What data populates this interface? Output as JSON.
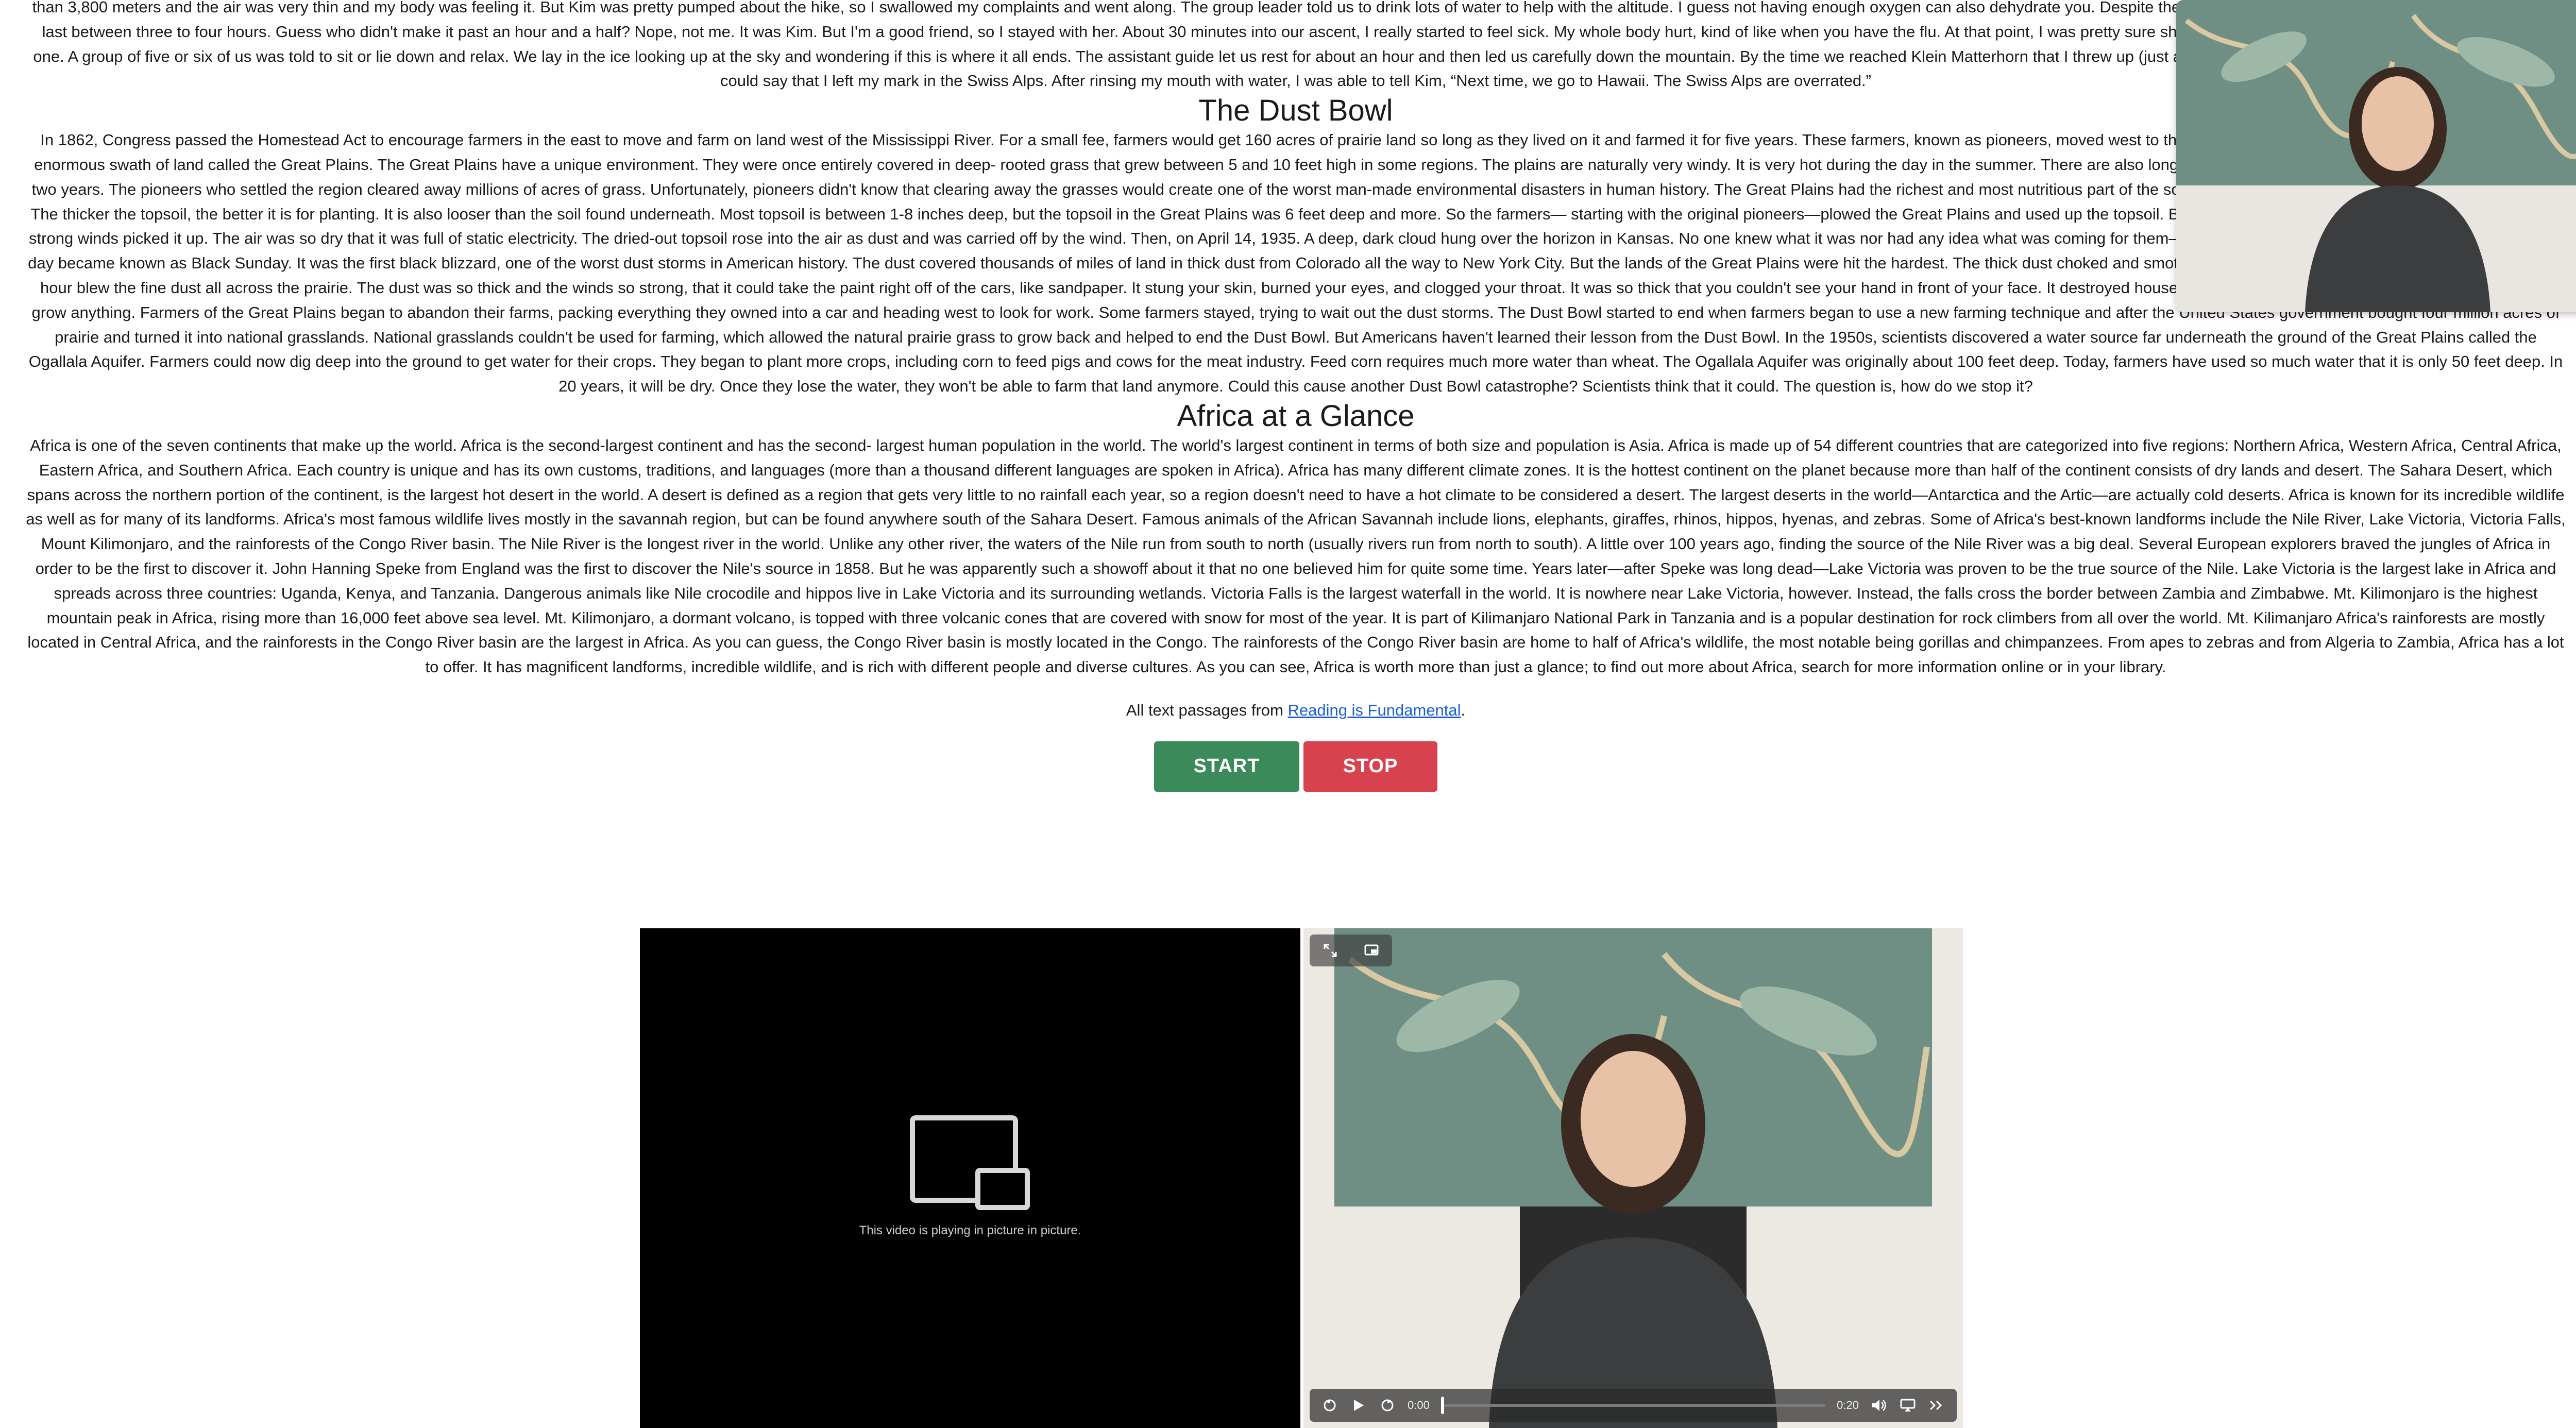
{
  "passages": {
    "hike_tail": "than 3,800 meters and the air was very thin and my body was feeling it. But Kim was pretty pumped about the hike, so I swallowed my complaints and went along. The group leader told us to drink lots of water to help with the altitude. I guess not having enough oxygen can also dehydrate you. Despite the water, I began to feel sick. The hike was supposed to last between three to four hours. Guess who didn't make it past an hour and a half? Nope, not me. It was Kim. But I'm a good friend, so I stayed with her. About 30 minutes into our ascent, I really started to feel sick. My whole body hurt, kind of like when you have the flu. At that point, I was pretty sure she couldn't go any farther. Luckily, Kim wasn't the only one. A group of five or six of us was told to sit or lie down and relax. We lay in the ice looking up at the sky and wondering if this is where it all ends. The assistant guide let us rest for about an hour and then led us carefully down the mountain. By the time we reached Klein Matterhorn that I threw up (just another fun symptom of altitude sickness). I guess you could say that I left my mark in the Swiss Alps. After rinsing my mouth with water, I was able to tell Kim, “Next time, we go to Hawaii. The Swiss Alps are overrated.”",
    "dust_bowl": {
      "title": "The Dust Bowl",
      "body": "In 1862, Congress passed the Homestead Act to encourage farmers in the east to move and farm on land west of the Mississippi River. For a small fee, farmers would get 160 acres of prairie land so long as they lived on it and farmed it for five years. These farmers, known as pioneers, moved west to the prairie land. The prairie land was located across an enormous swath of land called the Great Plains. The Great Plains have a unique environment. They were once entirely covered in deep- rooted grass that grew between 5 and 10 feet high in some regions. The plains are naturally very windy. It is very hot during the day in the summer. There are also long droughts (periods of little rain falls) that can last up to two years. The pioneers who settled the region cleared away millions of acres of grass. Unfortunately, pioneers didn't know that clearing away the grasses would create one of the worst man-made environmental disasters in human history. The Great Plains had the richest and most nutritious part of the soil. Topsoil is the soil in which farmers plant their crops. The thicker the topsoil, the better it is for planting. It is also looser than the soil found underneath. Most topsoil is between 1-8 inches deep, but the topsoil in the Great Plains was 6 feet deep and more. So the farmers— starting with the original pioneers—plowed the Great Plains and used up the topsoil. By 1934, the rain stopped, the topsoil dried out, and the strong winds picked it up. The air was so dry that it was full of static electricity. The dried-out topsoil rose into the air as dust and was carried off by the wind. Then, on April 14, 1935. A deep, dark cloud hung over the horizon in Kansas. No one knew what it was nor had any idea what was coming for them—some people thought it was the end of the world. This day became known as Black Sunday. It was the first black blizzard, one of the worst dust storms in American history. The dust covered thousands of miles of land in thick dust from Colorado all the way to New York City. But the lands of the Great Plains were hit the hardest. The thick dust choked and smothered farmers, even indoors. Winds of 40-60 miles per hour blew the fine dust all across the prairie. The dust was so thick and the winds so strong, that it could take the paint right off of the cars, like sandpaper. It stung your skin, burned your eyes, and clogged your throat. It was so thick that you couldn't see your hand in front of your face. It destroyed houses and buildings, too. Worst of all, it was impossible to grow anything. Farmers of the Great Plains began to abandon their farms, packing everything they owned into a car and heading west to look for work. Some farmers stayed, trying to wait out the dust storms. The Dust Bowl started to end when farmers began to use a new farming technique and after the United States government bought four million acres of prairie and turned it into national grasslands. National grasslands couldn't be used for farming, which allowed the natural prairie grass to grow back and helped to end the Dust Bowl. But Americans haven't learned their lesson from the Dust Bowl. In the 1950s, scientists discovered a water source far underneath the ground of the Great Plains called the Ogallala Aquifer. Farmers could now dig deep into the ground to get water for their crops. They began to plant more crops, including corn to feed pigs and cows for the meat industry. Feed corn requires much more water than wheat. The Ogallala Aquifer was originally about 100 feet deep. Today, farmers have used so much water that it is only 50 feet deep. In 20 years, it will be dry. Once they lose the water, they won't be able to farm that land anymore. Could this cause another Dust Bowl catastrophe? Scientists think that it could. The question is, how do we stop it?"
    },
    "africa": {
      "title": "Africa at a Glance",
      "body": "Africa is one of the seven continents that make up the world. Africa is the second-largest continent and has the second- largest human population in the world. The world's largest continent in terms of both size and population is Asia. Africa is made up of 54 different countries that are categorized into five regions: Northern Africa, Western Africa, Central Africa, Eastern Africa, and Southern Africa. Each country is unique and has its own customs, traditions, and languages (more than a thousand different languages are spoken in Africa). Africa has many different climate zones. It is the hottest continent on the planet because more than half of the continent consists of dry lands and desert. The Sahara Desert, which spans across the northern portion of the continent, is the largest hot desert in the world. A desert is defined as a region that gets very little to no rainfall each year, so a region doesn't need to have a hot climate to be considered a desert. The largest deserts in the world—Antarctica and the Artic—are actually cold deserts. Africa is known for its incredible wildlife as well as for many of its landforms. Africa's most famous wildlife lives mostly in the savannah region, but can be found anywhere south of the Sahara Desert. Famous animals of the African Savannah include lions, elephants, giraffes, rhinos, hippos, hyenas, and zebras. Some of Africa's best-known landforms include the Nile River, Lake Victoria, Victoria Falls, Mount Kilimonjaro, and the rainforests of the Congo River basin. The Nile River is the longest river in the world. Unlike any other river, the waters of the Nile run from south to north (usually rivers run from north to south). A little over 100 years ago, finding the source of the Nile River was a big deal. Several European explorers braved the jungles of Africa in order to be the first to discover it. John Hanning Speke from England was the first to discover the Nile's source in 1858. But he was apparently such a showoff about it that no one believed him for quite some time. Years later—after Speke was long dead—Lake Victoria was proven to be the true source of the Nile. Lake Victoria is the largest lake in Africa and spreads across three countries: Uganda, Kenya, and Tanzania. Dangerous animals like Nile crocodile and hippos live in Lake Victoria and its surrounding wetlands. Victoria Falls is the largest waterfall in the world. It is nowhere near Lake Victoria, however. Instead, the falls cross the border between Zambia and Zimbabwe. Mt. Kilimonjaro is the highest mountain peak in Africa, rising more than 16,000 feet above sea level. Mt. Kilimonjaro, a dormant volcano, is topped with three volcanic cones that are covered with snow for most of the year. It is part of Kilimanjaro National Park in Tanzania and is a popular destination for rock climbers from all over the world. Mt. Kilimanjaro Africa's rainforests are mostly located in Central Africa, and the rainforests in the Congo River basin are the largest in Africa. As you can guess, the Congo River basin is mostly located in the Congo. The rainforests of the Congo River basin are home to half of Africa's wildlife, the most notable being gorillas and chimpanzees. From apes to zebras and from Algeria to Zambia, Africa has a lot to offer. It has magnificent landforms, incredible wildlife, and is rich with different people and diverse cultures. As you can see, Africa is worth more than just a glance; to find out more about Africa, search for more information online or in your library."
    }
  },
  "attribution": {
    "prefix": "All text passages from ",
    "link_text": "Reading is Fundamental",
    "suffix": "."
  },
  "buttons": {
    "start": "START",
    "stop": "STOP"
  },
  "pip_player": {
    "placeholder_text": "This video is playing in picture in picture."
  },
  "video_player": {
    "current_time": "0:00",
    "duration": "0:20",
    "progress_fraction": 0.0
  },
  "colors": {
    "start_button": "#3a8a5a",
    "stop_button": "#d8424e",
    "link": "#1a5fd1"
  }
}
